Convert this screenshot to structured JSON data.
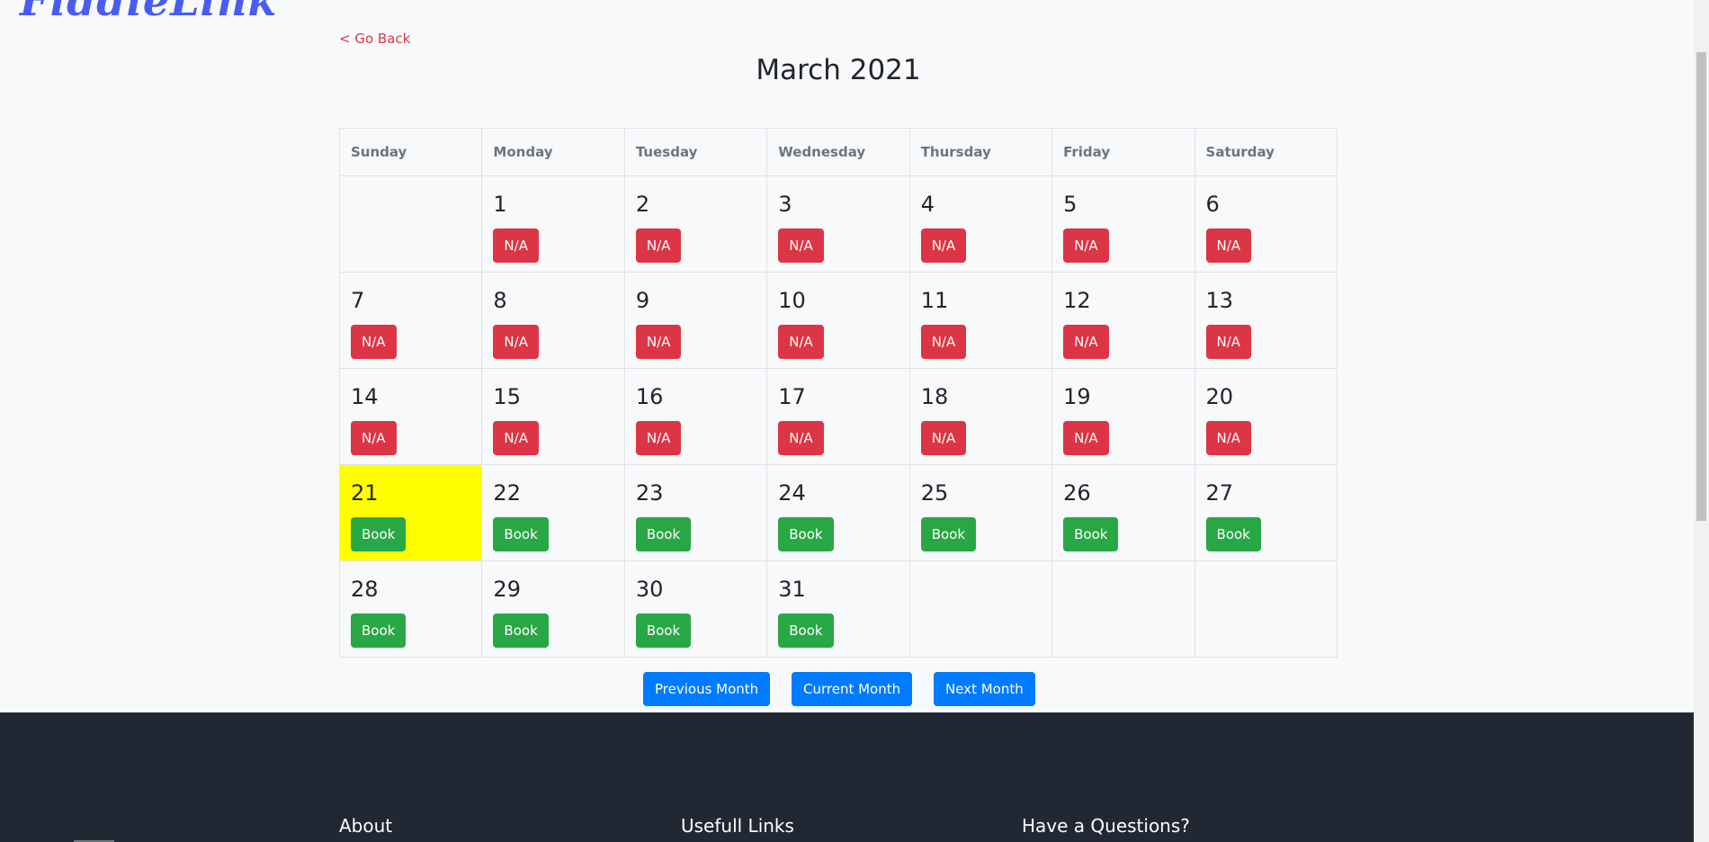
{
  "brand": {
    "logo_text": "FiddleLink"
  },
  "nav": {
    "go_back": "< Go Back"
  },
  "calendar": {
    "month_title": "March 2021",
    "weekdays": [
      "Sunday",
      "Monday",
      "Tuesday",
      "Wednesday",
      "Thursday",
      "Friday",
      "Saturday"
    ],
    "today": 21,
    "colors": {
      "today": "#ffff00",
      "unavailable": "#dc3545",
      "available": "#28a745"
    },
    "weeks": [
      [
        null,
        {
          "day": "1",
          "action": "N/A"
        },
        {
          "day": "2",
          "action": "N/A"
        },
        {
          "day": "3",
          "action": "N/A"
        },
        {
          "day": "4",
          "action": "N/A"
        },
        {
          "day": "5",
          "action": "N/A"
        },
        {
          "day": "6",
          "action": "N/A"
        }
      ],
      [
        {
          "day": "7",
          "action": "N/A"
        },
        {
          "day": "8",
          "action": "N/A"
        },
        {
          "day": "9",
          "action": "N/A"
        },
        {
          "day": "10",
          "action": "N/A"
        },
        {
          "day": "11",
          "action": "N/A"
        },
        {
          "day": "12",
          "action": "N/A"
        },
        {
          "day": "13",
          "action": "N/A"
        }
      ],
      [
        {
          "day": "14",
          "action": "N/A"
        },
        {
          "day": "15",
          "action": "N/A"
        },
        {
          "day": "16",
          "action": "N/A"
        },
        {
          "day": "17",
          "action": "N/A"
        },
        {
          "day": "18",
          "action": "N/A"
        },
        {
          "day": "19",
          "action": "N/A"
        },
        {
          "day": "20",
          "action": "N/A"
        }
      ],
      [
        {
          "day": "21",
          "action": "Book"
        },
        {
          "day": "22",
          "action": "Book"
        },
        {
          "day": "23",
          "action": "Book"
        },
        {
          "day": "24",
          "action": "Book"
        },
        {
          "day": "25",
          "action": "Book"
        },
        {
          "day": "26",
          "action": "Book"
        },
        {
          "day": "27",
          "action": "Book"
        }
      ],
      [
        {
          "day": "28",
          "action": "Book"
        },
        {
          "day": "29",
          "action": "Book"
        },
        {
          "day": "30",
          "action": "Book"
        },
        {
          "day": "31",
          "action": "Book"
        },
        null,
        null,
        null
      ]
    ]
  },
  "pager": {
    "previous": "Previous Month",
    "current": "Current Month",
    "next": "Next Month"
  },
  "footer": {
    "about": "About",
    "links": "Usefull Links",
    "questions": "Have a Questions?"
  }
}
